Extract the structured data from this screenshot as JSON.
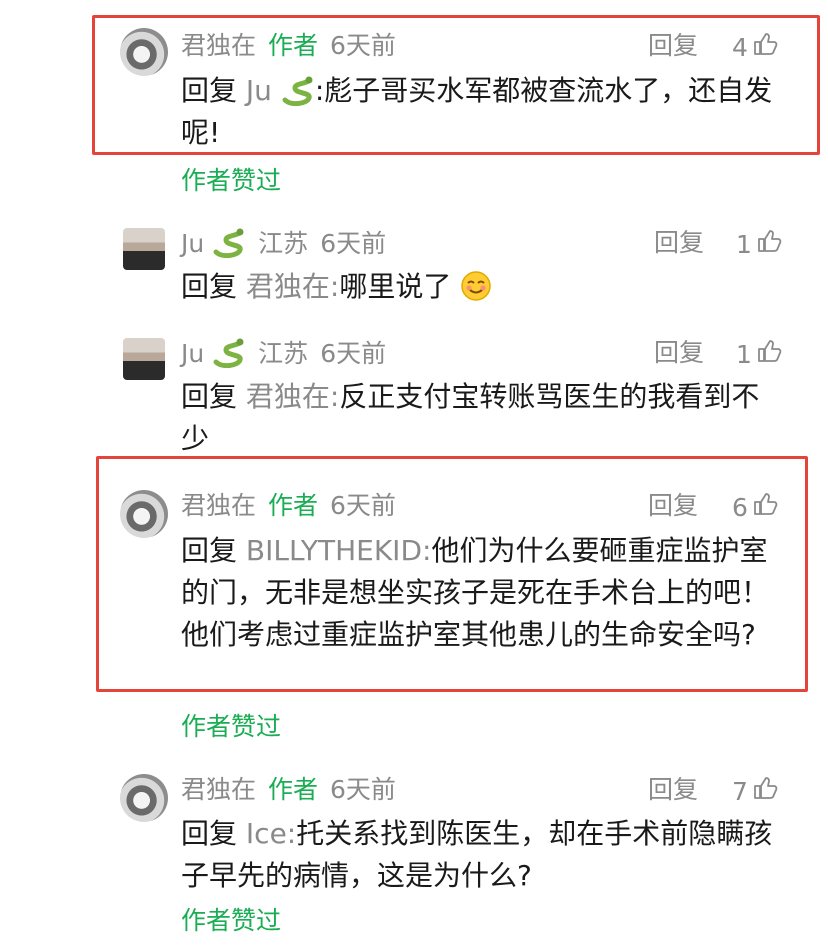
{
  "labels": {
    "reply": "回复",
    "author_tag": "作者",
    "author_liked": "作者赞过"
  },
  "comments": [
    {
      "name": "君独在",
      "is_author": true,
      "location": "",
      "time": "6天前",
      "reply_label": "回复",
      "likes": "4",
      "reply_prefix": "回复",
      "target": "Ju",
      "target_emoji": "snake-icon",
      "content": ":彪子哥买水军都被查流水了，还自发呢!",
      "author_liked": true,
      "highlighted": true
    },
    {
      "name": "Ju",
      "name_emoji": "snake-icon",
      "is_author": false,
      "location": "江苏",
      "time": "6天前",
      "reply_label": "回复",
      "likes": "1",
      "reply_prefix": "回复",
      "target": "君独在:",
      "content": "哪里说了",
      "content_emoji": "smile-icon",
      "author_liked": false,
      "highlighted": false
    },
    {
      "name": "Ju",
      "name_emoji": "snake-icon",
      "is_author": false,
      "location": "江苏",
      "time": "6天前",
      "reply_label": "回复",
      "likes": "1",
      "reply_prefix": "回复",
      "target": "君独在:",
      "content": "反正支付宝转账骂医生的我看到不少",
      "author_liked": false,
      "highlighted": false
    },
    {
      "name": "君独在",
      "is_author": true,
      "location": "",
      "time": "6天前",
      "reply_label": "回复",
      "likes": "6",
      "reply_prefix": "回复",
      "target": "BILLYTHEKID:",
      "content": "他们为什么要砸重症监护室的门，无非是想坐实孩子是死在手术台上的吧！他们考虑过重症监护室其他患儿的生命安全吗?",
      "author_liked": true,
      "highlighted": true
    },
    {
      "name": "君独在",
      "is_author": true,
      "location": "",
      "time": "6天前",
      "reply_label": "回复",
      "likes": "7",
      "reply_prefix": "回复",
      "target": "Ice:",
      "content": "托关系找到陈医生，却在手术前隐瞒孩子早先的病情，这是为什么?",
      "author_liked": true,
      "highlighted": false
    }
  ],
  "colors": {
    "green": "#1aad53",
    "gray": "#8a8a8a",
    "highlight_border": "#e5443a"
  }
}
